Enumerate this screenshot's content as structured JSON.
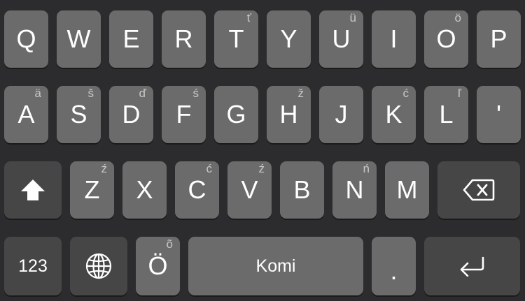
{
  "keyboard": {
    "layout_name": "Komi",
    "rows": [
      [
        {
          "label": "Q",
          "hint": ""
        },
        {
          "label": "W",
          "hint": ""
        },
        {
          "label": "E",
          "hint": ""
        },
        {
          "label": "R",
          "hint": ""
        },
        {
          "label": "T",
          "hint": "ť"
        },
        {
          "label": "Y",
          "hint": ""
        },
        {
          "label": "U",
          "hint": "ü"
        },
        {
          "label": "I",
          "hint": ""
        },
        {
          "label": "O",
          "hint": "ö"
        },
        {
          "label": "P",
          "hint": ""
        }
      ],
      [
        {
          "label": "A",
          "hint": "ä"
        },
        {
          "label": "S",
          "hint": "š"
        },
        {
          "label": "D",
          "hint": "ď"
        },
        {
          "label": "F",
          "hint": "ś"
        },
        {
          "label": "G",
          "hint": ""
        },
        {
          "label": "H",
          "hint": "ž"
        },
        {
          "label": "J",
          "hint": ""
        },
        {
          "label": "K",
          "hint": "ć"
        },
        {
          "label": "L",
          "hint": "ľ"
        },
        {
          "label": "'",
          "hint": ""
        }
      ],
      [
        {
          "label": "Z",
          "hint": "ź"
        },
        {
          "label": "X",
          "hint": ""
        },
        {
          "label": "C",
          "hint": "ć"
        },
        {
          "label": "V",
          "hint": "ź"
        },
        {
          "label": "B",
          "hint": ""
        },
        {
          "label": "N",
          "hint": "ń"
        },
        {
          "label": "M",
          "hint": ""
        }
      ]
    ],
    "bottom": {
      "numbers_label": "123",
      "o_umlaut_label": "Ö",
      "o_umlaut_hint": "õ",
      "space_label": "Komi",
      "period_label": "."
    },
    "icons": {
      "shift": "shift-icon",
      "backspace": "backspace-icon",
      "globe": "globe-icon",
      "return": "return-icon"
    },
    "colors": {
      "background": "#2c2c2e",
      "letter_key": "#6b6b6b",
      "function_key": "#464646",
      "text": "#ffffff",
      "hint_text": "#c8c8c8"
    }
  }
}
